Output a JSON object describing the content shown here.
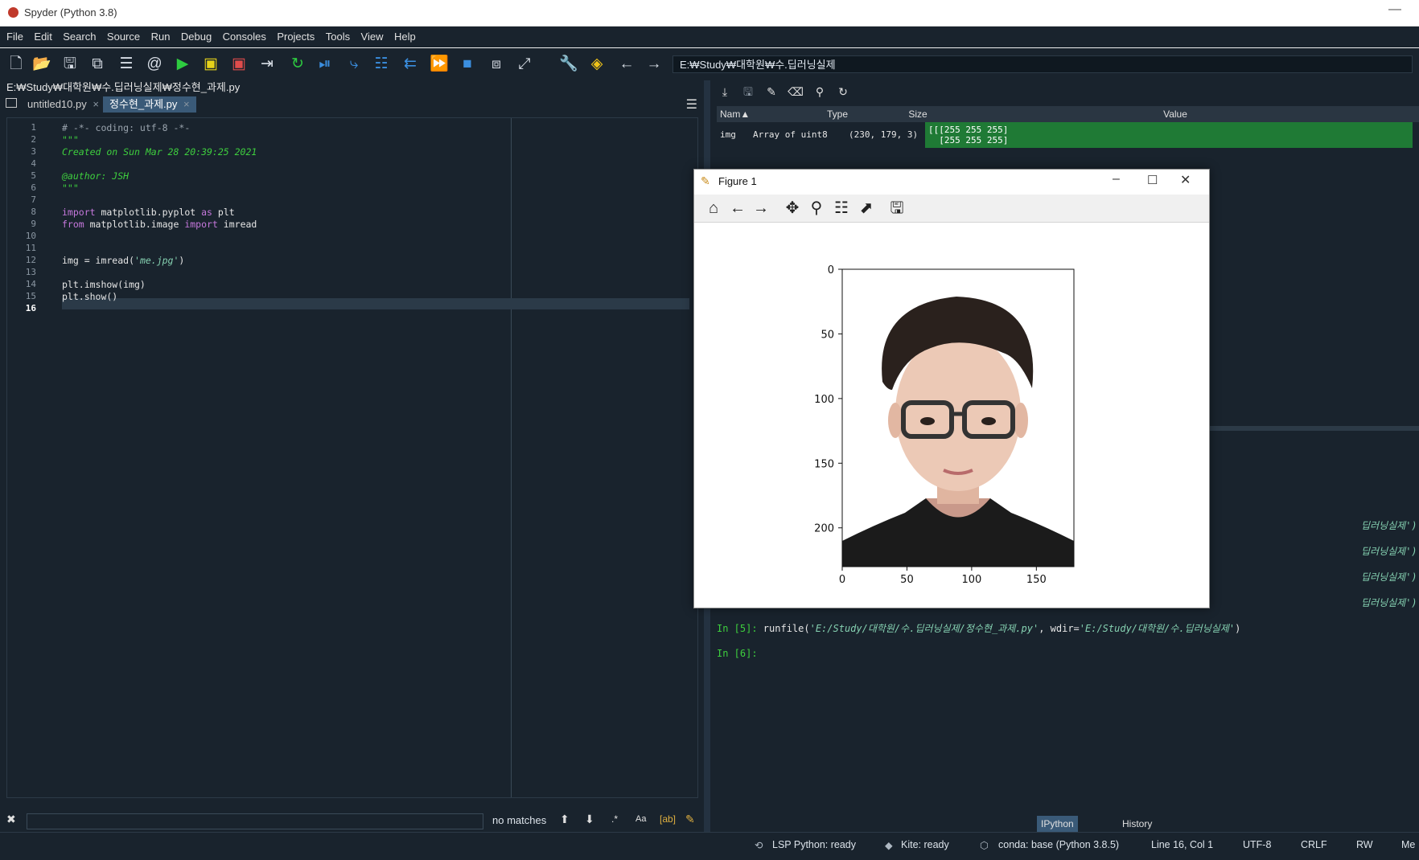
{
  "window": {
    "title": "Spyder (Python 3.8)",
    "minimize": "—"
  },
  "menu": [
    "File",
    "Edit",
    "Search",
    "Source",
    "Run",
    "Debug",
    "Consoles",
    "Projects",
    "Tools",
    "View",
    "Help"
  ],
  "toolbar": {
    "working_dir": "E:₩Study₩대학원₩수.딥러닝실제"
  },
  "editor": {
    "file_path": "E:₩Study₩대학원₩수.딥러닝실제₩정수현_과제.py",
    "tabs": [
      {
        "label": "untitled10.py",
        "close": "×"
      },
      {
        "label": "정수현_과제.py",
        "close": "×"
      }
    ],
    "line_numbers": [
      "1",
      "2",
      "3",
      "4",
      "5",
      "6",
      "7",
      "8",
      "9",
      "10",
      "11",
      "12",
      "13",
      "14",
      "15",
      "16"
    ],
    "code": {
      "l1": "# -*- coding: utf-8 -*-",
      "l2": "\"\"\"",
      "l3": "Created on Sun Mar 28 20:39:25 2021",
      "l5": "@author: JSH",
      "l6": "\"\"\"",
      "l8_kw": "import",
      "l8_mod": " matplotlib.pyplot ",
      "l8_as": "as",
      "l8_alias": " plt",
      "l9_from": "from",
      "l9_mod": " matplotlib.image ",
      "l9_imp": "import",
      "l9_name": " imread",
      "l12_a": "img = imread(",
      "l12_str": "'me.jpg'",
      "l12_b": ")",
      "l14": "plt.imshow(img)",
      "l15": "plt.show()"
    }
  },
  "find": {
    "status": "no matches",
    "case_label": "Aa"
  },
  "variables": {
    "columns": [
      "Nam▲",
      "Type",
      "Size",
      "Value"
    ],
    "row": {
      "name": "img",
      "type": "Array of uint8",
      "size": "(230, 179, 3)",
      "value_line1": "[[[255 255 255]",
      "value_line2": "  [255 255 255]"
    }
  },
  "console": {
    "partial_tail": "딥러닝실제')",
    "in5_prompt": "In [5]: ",
    "in5_cmd": "runfile(",
    "in5_path": "'E:/Study/대학원/수.딥러닝실제/정수현_과제.py'",
    "in5_mid": ", wdir=",
    "in5_wdir": "'E:/Study/대학원/수.딥러닝실제'",
    "in5_end": ")",
    "in6_prompt": "In [6]: ",
    "tabs": [
      "IPython console",
      "History"
    ]
  },
  "status": {
    "lsp": "LSP Python: ready",
    "kite": "Kite: ready",
    "conda": "conda: base (Python 3.8.5)",
    "position": "Line 16, Col 1",
    "encoding": "UTF-8",
    "eol": "CRLF",
    "rw": "RW",
    "mem": "Me"
  },
  "figure": {
    "title": "Figure 1",
    "chart_data": {
      "type": "image",
      "x_ticks": [
        "0",
        "50",
        "100",
        "150"
      ],
      "y_ticks": [
        "0",
        "50",
        "100",
        "150",
        "200"
      ],
      "xlim": [
        0,
        179
      ],
      "ylim": [
        230,
        0
      ]
    }
  }
}
